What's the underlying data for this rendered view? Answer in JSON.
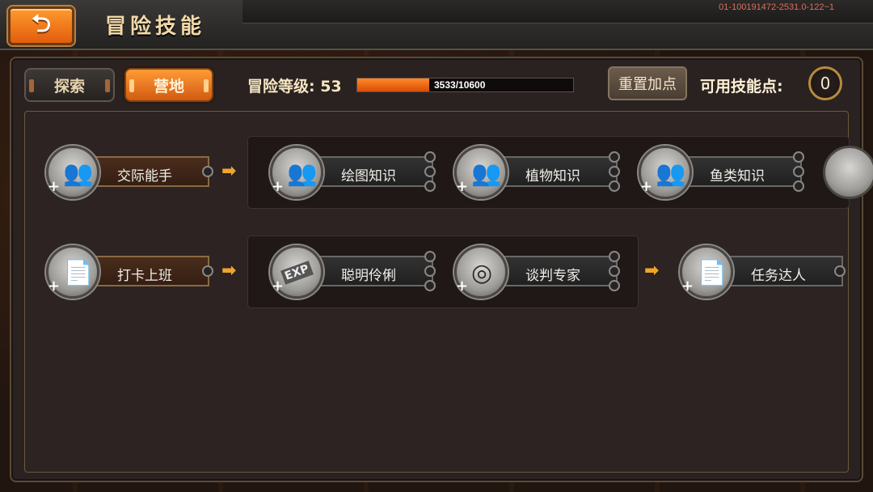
{
  "topbar": {
    "title": "冒险技能",
    "build_info": "01-100191472-2531.0-122~1"
  },
  "tabs": {
    "explore": "探索",
    "camp": "营地",
    "active": "camp"
  },
  "level": {
    "label": "冒险等级: 53",
    "xp_text": "3533/10600",
    "xp_current": 3533,
    "xp_max": 10600
  },
  "reset_label": "重置加点",
  "skill_points": {
    "label": "可用技能点:",
    "value": "0"
  },
  "colors": {
    "accent": "#ff8a2a",
    "gold": "#b88a3c",
    "arrow": "#f0a52a"
  },
  "rows": [
    {
      "base": {
        "name": "交际能手",
        "icon": "people-icon"
      },
      "group": [
        {
          "name": "绘图知识",
          "icon": "people-icon"
        },
        {
          "name": "植物知识",
          "icon": "people-icon"
        },
        {
          "name": "鱼类知识",
          "icon": "people-icon"
        }
      ]
    },
    {
      "base": {
        "name": "打卡上班",
        "icon": "document-icon"
      },
      "group": [
        {
          "name": "聪明伶俐",
          "icon": "exp-card-icon"
        },
        {
          "name": "谈判专家",
          "icon": "coins-icon"
        }
      ],
      "next": {
        "name": "任务达人",
        "icon": "document-icon"
      }
    }
  ]
}
